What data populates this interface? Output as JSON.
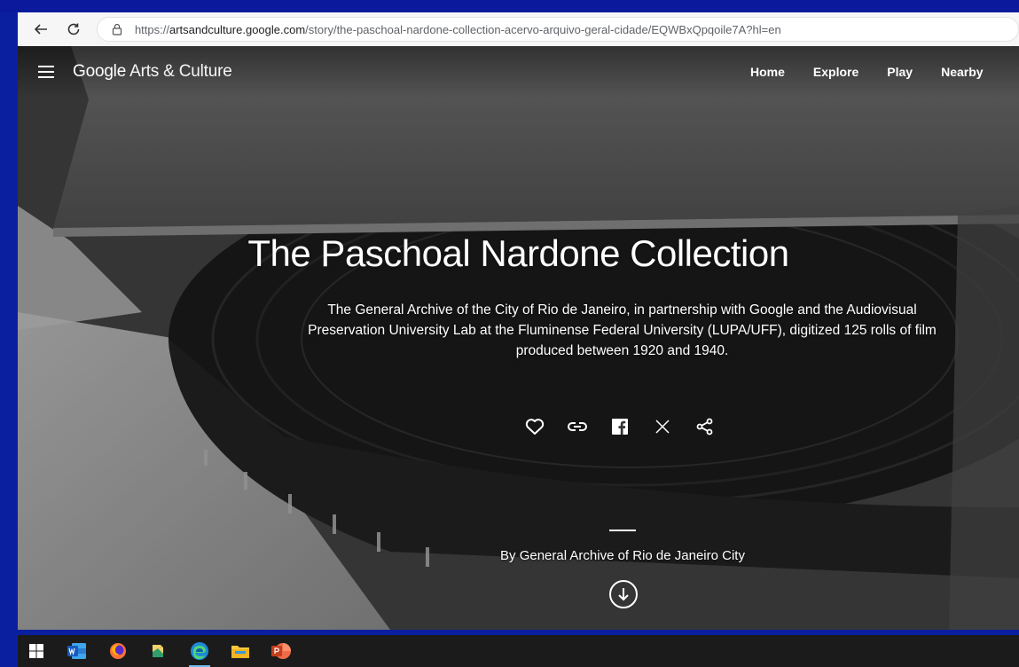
{
  "browser": {
    "url_prefix": "https://",
    "url_domain": "artsandculture.google.com",
    "url_path": "/story/the-paschoal-nardone-collection-acervo-arquivo-geral-cidade/EQWBxQpqoile7A?hl=en"
  },
  "header": {
    "brand_google": "Google",
    "brand_rest": " Arts & Culture",
    "nav": [
      "Home",
      "Explore",
      "Play",
      "Nearby"
    ]
  },
  "hero": {
    "title": "The Paschoal Nardone Collection",
    "subtitle": "The General Archive of the City of Rio de Janeiro, in partnership with Google and the Audiovisual Preservation University Lab at the Fluminense Federal University (LUPA/UFF), digitized 125 rolls of film produced between 1920 and 1940.",
    "byline": "By General Archive of Rio de Janeiro City",
    "actions": [
      "heart-icon",
      "link-icon",
      "facebook-icon",
      "x-icon",
      "share-icon"
    ]
  },
  "taskbar": {
    "items": [
      "windows-start-icon",
      "word-icon",
      "firefox-icon",
      "file-explorer-doc-icon",
      "edge-icon",
      "file-explorer-icon",
      "powerpoint-icon"
    ]
  },
  "colors": {
    "slide_bg": "#0a1fa0",
    "taskbar_bg": "#1b1b1b"
  }
}
